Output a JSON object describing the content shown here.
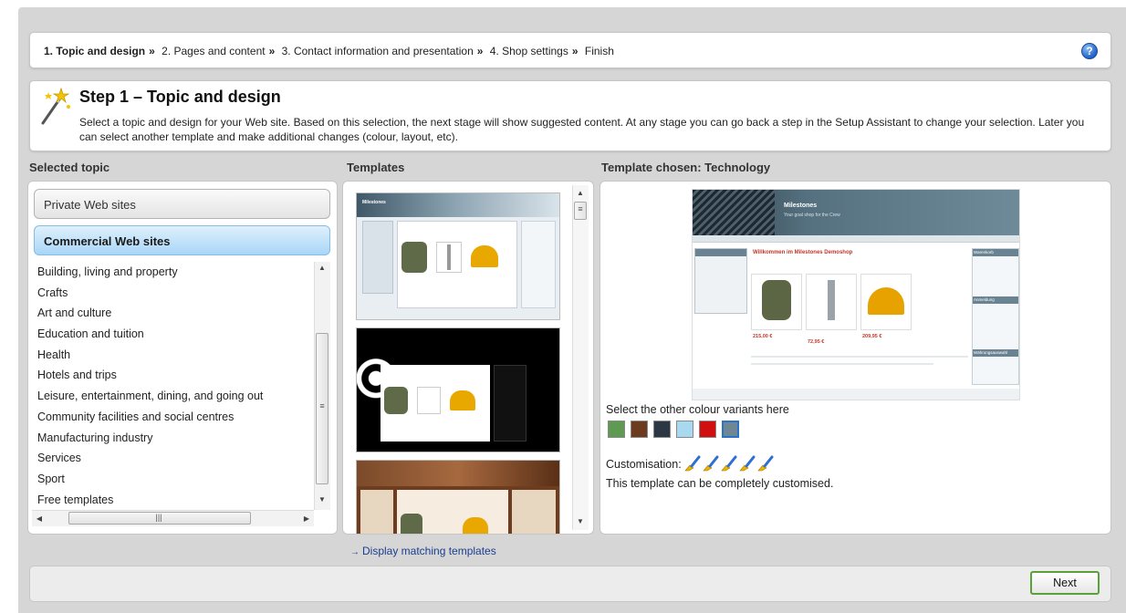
{
  "breadcrumb": {
    "steps": [
      "1. Topic and design",
      "2. Pages and content",
      "3. Contact information and presentation",
      "4. Shop settings",
      "Finish"
    ],
    "separator": "»"
  },
  "step": {
    "title": "Step 1 – Topic and design",
    "description": "Select a topic and design for your Web site. Based on this selection, the next stage will show suggested content. At any stage you can go back a step in the Setup Assistant to change your selection. Later you can select another template and make additional changes (colour, layout, etc)."
  },
  "topics": {
    "heading": "Selected topic",
    "tabs": [
      {
        "label": "Private Web sites",
        "active": false
      },
      {
        "label": "Commercial Web sites",
        "active": true
      }
    ],
    "items": [
      "Building, living and property",
      "Crafts",
      "Art and culture",
      "Education and tuition",
      "Health",
      "Hotels and trips",
      "Leisure, entertainment, dining, and going out",
      "Community facilities and social centres",
      "Manufacturing industry",
      "Services",
      "Sport",
      "Free templates"
    ]
  },
  "templates": {
    "heading": "Templates",
    "link": "Display matching templates",
    "thumb_titles": [
      "Milestones",
      "",
      "Milestones"
    ]
  },
  "chosen": {
    "heading": "Template chosen: Technology",
    "preview": {
      "site_title": "Milestones",
      "site_subtitle": "Your goal shop for the Crew",
      "shop_heading": "Willkommen im Milestones Demoshop",
      "prices": [
        "215,00 €",
        "72,95 €",
        "209,95 €"
      ],
      "sidebar": [
        "Startseite",
        "Warenkorb",
        "Anmeldung",
        "Währungsauswahl"
      ]
    },
    "variants_label": "Select the other colour variants here",
    "swatches": [
      {
        "color": "#5e9a52",
        "name": "green"
      },
      {
        "color": "#6b3a1f",
        "name": "brown"
      },
      {
        "color": "#2b3844",
        "name": "dark-slate"
      },
      {
        "color": "#a9d9ee",
        "name": "light-blue"
      },
      {
        "color": "#d01010",
        "name": "red"
      },
      {
        "color": "#6f8694",
        "name": "steel-grey",
        "selected": true
      }
    ],
    "customisation_label": "Customisation:",
    "customisation_level": 5,
    "customisation_desc": "This template can be completely customised."
  },
  "footer": {
    "next_label": "Next"
  }
}
